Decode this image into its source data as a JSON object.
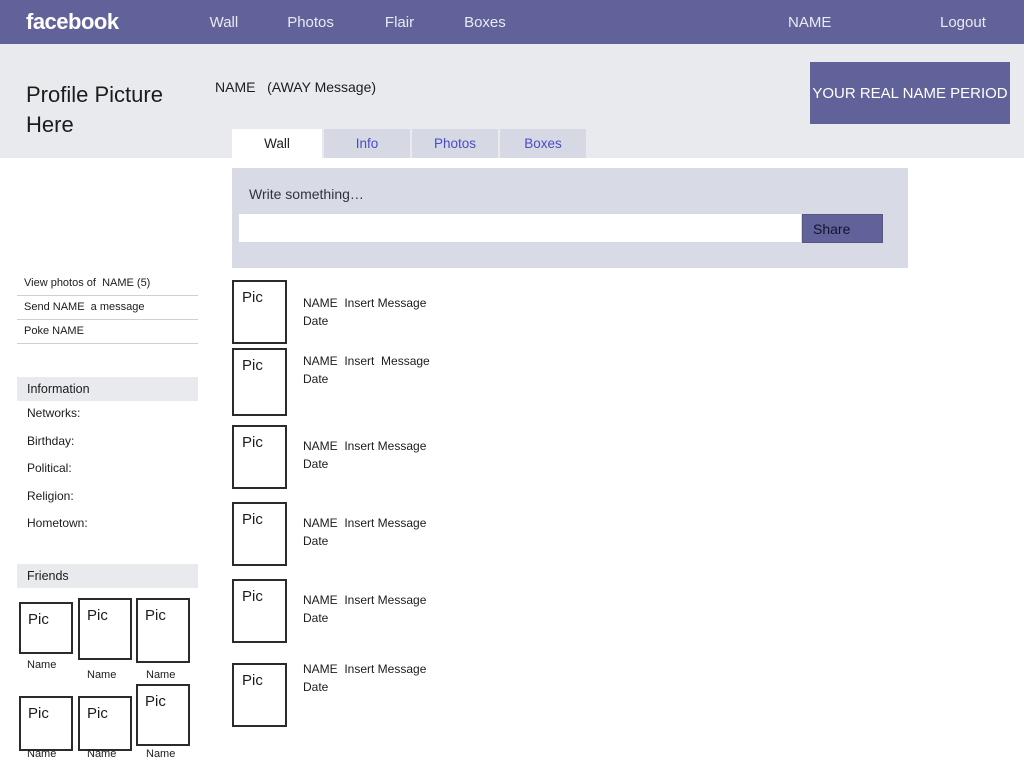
{
  "topbar": {
    "brand": "facebook",
    "nav": [
      {
        "id": "wall",
        "label": "Wall"
      },
      {
        "id": "photos",
        "label": "Photos"
      },
      {
        "id": "flair",
        "label": "Flair"
      },
      {
        "id": "boxes",
        "label": "Boxes"
      }
    ],
    "account_name": "NAME",
    "logout": "Logout",
    "bg_color": "#62629a"
  },
  "profile": {
    "picture_placeholder": "Profile Picture Here",
    "name_line": "NAME   (AWAY Message)",
    "real_name_banner": "YOUR REAL NAME PERIOD",
    "band_bg": "#e8eaee"
  },
  "tabs": [
    {
      "id": "wall",
      "label": "Wall",
      "active": true
    },
    {
      "id": "info",
      "label": "Info",
      "active": false
    },
    {
      "id": "photos",
      "label": "Photos",
      "active": false
    },
    {
      "id": "boxes",
      "label": "Boxes",
      "active": false
    }
  ],
  "sidebar": {
    "links": [
      {
        "id": "view-photos",
        "label": "View photos of  NAME (5)"
      },
      {
        "id": "send-message",
        "label": "Send NAME  a message"
      },
      {
        "id": "poke",
        "label": "Poke NAME"
      }
    ],
    "information": {
      "heading": "Information",
      "rows": [
        {
          "id": "networks",
          "label": "Networks:"
        },
        {
          "id": "birthday",
          "label": "Birthday:"
        },
        {
          "id": "political",
          "label": "Political:"
        },
        {
          "id": "religion",
          "label": "Religion:"
        },
        {
          "id": "hometown",
          "label": "Hometown:"
        }
      ]
    },
    "friends": {
      "heading": "Friends",
      "items": [
        {
          "pic": "Pic",
          "name": "Name"
        },
        {
          "pic": "Pic",
          "name": "Name"
        },
        {
          "pic": "Pic",
          "name": "Name"
        },
        {
          "pic": "Pic",
          "name": "Name"
        },
        {
          "pic": "Pic",
          "name": "Name"
        },
        {
          "pic": "Pic",
          "name": "Name"
        }
      ]
    }
  },
  "composer": {
    "label": "Write something…",
    "value": "",
    "placeholder": "",
    "share_label": "Share",
    "bg_color": "#d8dbe5",
    "share_color": "#62629a"
  },
  "wall": {
    "posts": [
      {
        "pic": "Pic",
        "message": "NAME  Insert Message",
        "date": "Date"
      },
      {
        "pic": "Pic",
        "message": "NAME  Insert  Message",
        "date": "Date"
      },
      {
        "pic": "Pic",
        "message": "NAME  Insert Message",
        "date": "Date"
      },
      {
        "pic": "Pic",
        "message": "NAME  Insert Message",
        "date": "Date"
      },
      {
        "pic": "Pic",
        "message": "NAME  Insert Message",
        "date": "Date"
      },
      {
        "pic": "Pic",
        "message": "NAME  Insert Message",
        "date": "Date"
      }
    ]
  }
}
